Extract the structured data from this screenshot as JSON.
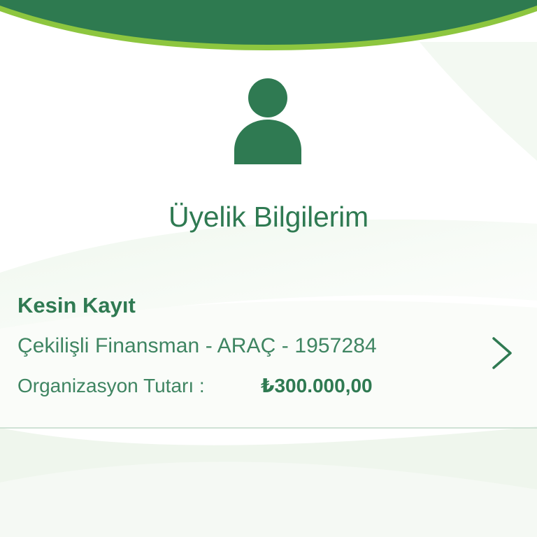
{
  "colors": {
    "primary_green": "#2f7a52",
    "text_green": "#3f8562",
    "header_green": "#2e7a50",
    "header_lime_stripe": "#8dc63f",
    "divider": "#cfe2d5"
  },
  "header": {
    "avatar_icon": "user-icon"
  },
  "page": {
    "title": "Üyelik Bilgilerim"
  },
  "membership": {
    "status": "Kesin Kayıt",
    "product": "Çekilişli Finansman - ARAÇ - 1957284",
    "amount_label": "Organizasyon Tutarı :",
    "amount_value": "₺300.000,00",
    "chevron_icon": "chevron-right-icon"
  }
}
